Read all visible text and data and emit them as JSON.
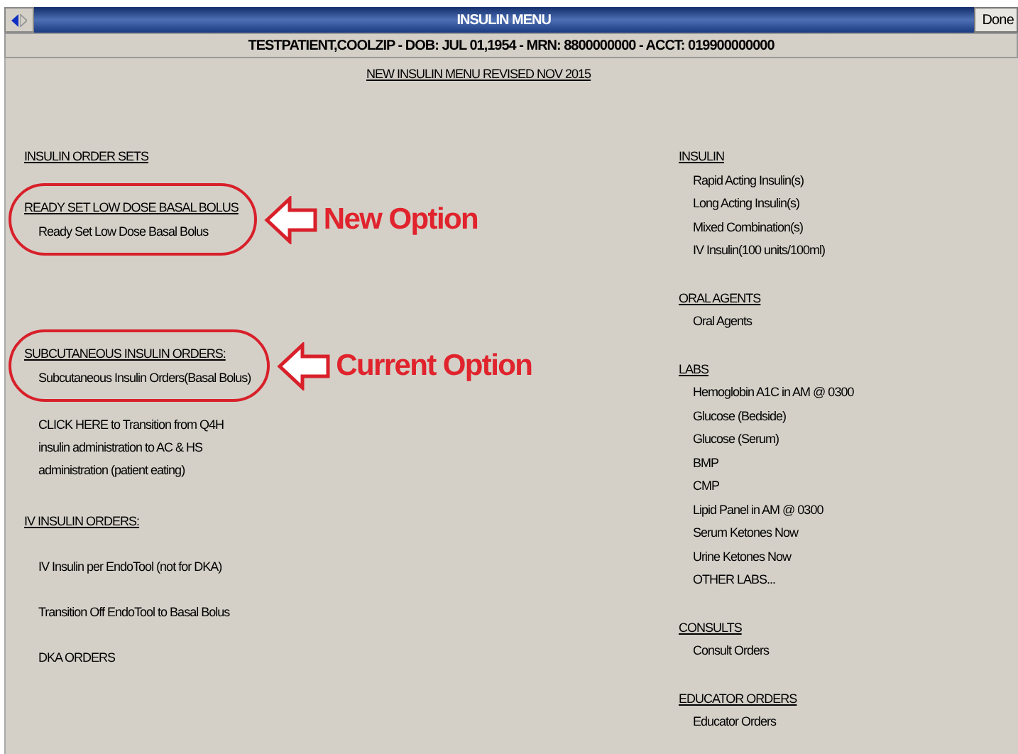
{
  "window": {
    "title": "INSULIN MENU",
    "done_button": "Done"
  },
  "patient_bar": "TESTPATIENT,COOLZIP - DOB: JUL 01,1954 - MRN: 8800000000 - ACCT: 019900000000",
  "subtitle": "NEW INSULIN MENU REVISED NOV 2015",
  "left_column": [
    {
      "kind": "header",
      "text": "INSULIN ORDER SETS"
    },
    {
      "kind": "group",
      "heading": "READY SET LOW DOSE BASAL BOLUS",
      "items": [
        "Ready Set Low Dose Basal Bolus"
      ],
      "spaced": false,
      "callout": "New Option"
    },
    {
      "kind": "group",
      "heading": "SUBCUTANEOUS INSULIN ORDERS:",
      "items": [
        "Subcutaneous Insulin Orders(Basal Bolus)"
      ],
      "spaced": false,
      "callout": "Current Option"
    },
    {
      "kind": "paragraph",
      "text": "CLICK HERE to Transition from Q4H insulin administration to AC & HS administration (patient eating)"
    },
    {
      "kind": "group",
      "heading": "IV INSULIN ORDERS:",
      "items": [
        "IV Insulin per EndoTool (not for DKA)",
        "Transition Off EndoTool to Basal Bolus",
        "DKA ORDERS"
      ],
      "spaced": true
    }
  ],
  "right_column": [
    {
      "heading": "INSULIN",
      "items": [
        "Rapid Acting Insulin(s)",
        "Long Acting Insulin(s)",
        "Mixed Combination(s)",
        "IV Insulin(100 units/100ml)"
      ]
    },
    {
      "heading": "ORAL AGENTS",
      "items": [
        "Oral Agents"
      ]
    },
    {
      "heading": "LABS",
      "items": [
        "Hemoglobin A1C in AM @ 0300",
        "Glucose (Bedside)",
        "Glucose (Serum)",
        "BMP",
        "CMP",
        "Lipid Panel in AM @ 0300",
        "Serum Ketones Now",
        "Urine Ketones Now",
        "OTHER LABS..."
      ]
    },
    {
      "heading": "CONSULTS",
      "items": [
        "Consult Orders"
      ]
    },
    {
      "heading": "EDUCATOR ORDERS",
      "items": [
        "Educator Orders"
      ]
    }
  ]
}
